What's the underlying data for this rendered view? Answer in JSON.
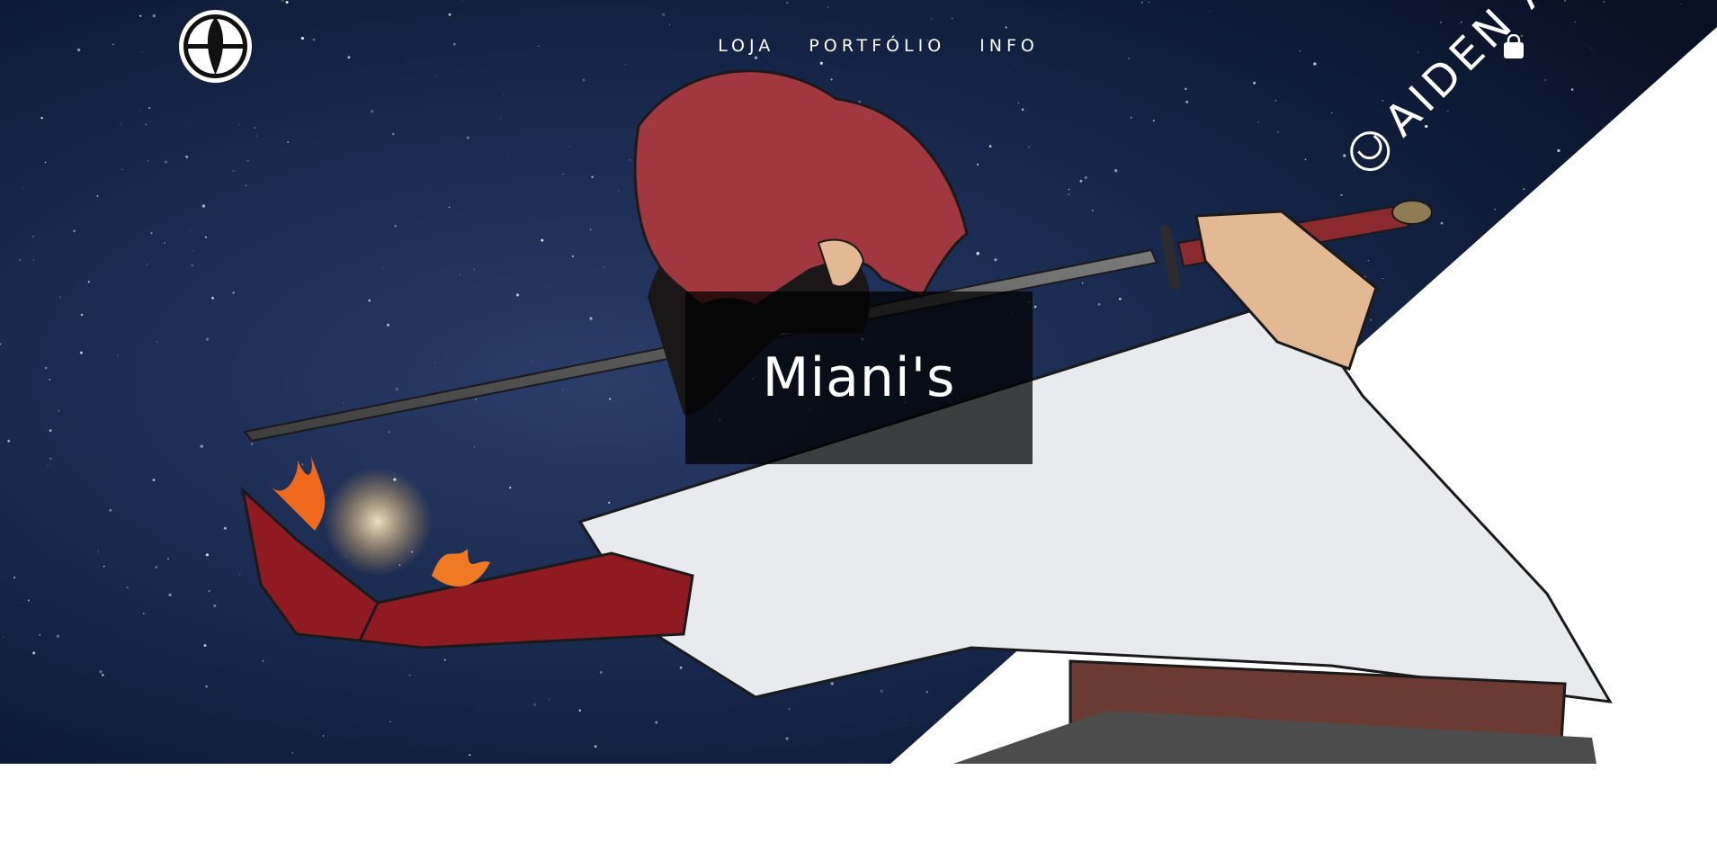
{
  "header": {
    "logo_icon": "feather-emblem-icon",
    "nav": [
      {
        "label": "LOJA"
      },
      {
        "label": "PORTFÓLIO"
      },
      {
        "label": "INFO"
      }
    ],
    "cart_icon": "shopping-bag-icon"
  },
  "hero": {
    "title": "Miani's",
    "watermark_text": "AIDEN AKAGI",
    "watermark_icon": "aiden-akagi-seal-icon",
    "artwork": "anime-swordsman-over-starry-sky"
  },
  "colors": {
    "sky": "#0c1a33",
    "hair": "#a1383f",
    "title_overlay": "#000000",
    "text": "#ffffff"
  }
}
